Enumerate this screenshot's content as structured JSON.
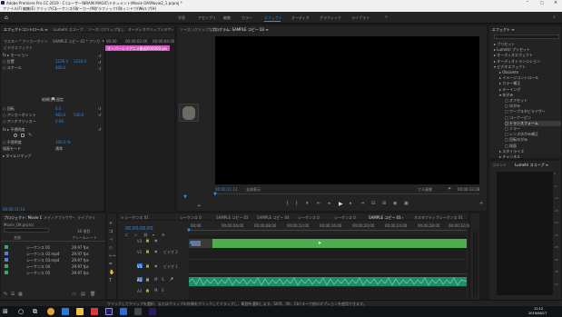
{
  "titlebar": {
    "title": "Adobe Premiere Pro CC 2019 - C:\\ユーザー\\NRAIN MAGIC\\ドキュメント\\Movie OA\\Movie2_1.prproj *"
  },
  "menu": [
    "ファイル(F)",
    "編集(E)",
    "クリップ(C)",
    "シーケンス(S)",
    "マーカー(M)",
    "グラフィック(G)",
    "ウィンドウ(W)",
    "ヘルプ(H)"
  ],
  "workspaces": [
    "学習",
    "アセンブリ",
    "編集",
    "カラー",
    "エフェクト",
    "オーディオ",
    "グラフィック",
    "ライブラリ"
  ],
  "workspace_active": "エフェクト",
  "effect_controls": {
    "tabs": [
      "エフェクトコントロール ≡",
      "Lumetri スコープ",
      "ソース: (クリップなし)",
      "オーディオクリップミキサー: シーケンス 05"
    ],
    "clip_label": "マスター * アンカーポイント... ∨",
    "seq_label": "SAMPLE コピー 01 * アンカ...",
    "video_effects": "ビデオエフェクト",
    "rows": [
      {
        "label": "fx  ▸ モーション",
        "v1": "",
        "v2": ""
      },
      {
        "label": "      ○ 位置",
        "v1": "1226.0",
        "v2": "1226.0"
      },
      {
        "label": "      ○ スケール",
        "v1": "400.0",
        "v2": ""
      },
      {
        "label": "        縦横比を固定",
        "v1": "",
        "v2": ""
      },
      {
        "label": "      ○ 回転",
        "v1": "0.0",
        "v2": ""
      },
      {
        "label": "      ○ アンカーポイント",
        "v1": "960.0",
        "v2": "540.0"
      },
      {
        "label": "      ○ アンチフリッカー",
        "v1": "0.00",
        "v2": ""
      },
      {
        "label": "fx  ▸ 不透明度",
        "v1": "",
        "v2": ""
      },
      {
        "label": "      ○ 不透明度",
        "v1": "100.0 %",
        "v2": ""
      },
      {
        "label": "        描画モード",
        "v1": "通常",
        "v2": ""
      },
      {
        "label": "▸ タイムリマップ",
        "v1": "",
        "v2": ""
      }
    ],
    "clip_name": "オーバーレイアニメ動画000000.png",
    "timecodes": [
      "00:00",
      "00:00:02:00",
      "00:00:04:00",
      "00:00:06:00"
    ],
    "current_time": "00:00:11:14"
  },
  "program": {
    "tab": "プログラム: SAMPLE コピー 03 ≡",
    "timecode_left": "00:00:11:14",
    "fit": "全体表示",
    "quality": "フル画質",
    "timecode_right": "00:00:33:28"
  },
  "project": {
    "tabs": [
      "プロジェクト: Movie OA_1 ≡",
      "メディアブラウザー",
      "ライブラリ"
    ],
    "file": "Movie_OA.prproj",
    "count": "16 項目",
    "col_name": "名前",
    "col_rate": "フレームレート",
    "items": [
      {
        "name": "シーケンス 01",
        "rate": "29.97 fps",
        "color": "#3aa86a"
      },
      {
        "name": "シーケンス 02.mp4",
        "rate": "29.97 fps",
        "color": "#5a7fd6"
      },
      {
        "name": "シーケンス 03.mp4",
        "rate": "29.97 fps",
        "color": "#5a7fd6"
      },
      {
        "name": "シーケンス 04",
        "rate": "29.97 fps",
        "color": "#3aa86a"
      },
      {
        "name": "シーケンス 05",
        "rate": "29.97 fps",
        "color": "#3aa86a"
      }
    ]
  },
  "timeline": {
    "tabs": [
      "× シーケンス 01",
      "シーケンス 02",
      "SAMPLE コピー 03",
      "SAMPLE コピー 04",
      "シーケンス 03",
      "シーケンス 04",
      "SAMPLE コピー 03 ≡",
      "オルタナティブシーケンス 01"
    ],
    "active_tab": "SAMPLE コピー 03 ≡",
    "timecode": "00;00;00;00",
    "ruler": [
      "00;00",
      "00;00;04;00",
      "00;00;08;00",
      "00;00;12;00",
      "00;00;16;00",
      "00;00;20;00",
      "00;00;24;00",
      "00;00;28;00",
      "00;00;32;00"
    ],
    "tracks": [
      {
        "name": "V3",
        "label": ""
      },
      {
        "name": "V2",
        "label": "ビデオ 2"
      },
      {
        "name": "V1",
        "label": "ビデオ 1"
      },
      {
        "name": "A1",
        "label": ""
      },
      {
        "name": "A2",
        "label": ""
      }
    ],
    "master": "マスター",
    "master_value": "0.0"
  },
  "effects": {
    "title": "エフェクト ≡",
    "items": [
      {
        "label": "▸ プリセット",
        "indent": 0
      },
      {
        "label": "▸ Lumetri プリセット",
        "indent": 0
      },
      {
        "label": "▸ オーディオエフェクト",
        "indent": 0
      },
      {
        "label": "▸ オーディオトランジション",
        "indent": 0
      },
      {
        "label": "▾ ビデオエフェクト",
        "indent": 0
      },
      {
        "label": "▸ Obsolete",
        "indent": 1
      },
      {
        "label": "▸ イメージコントロール",
        "indent": 1
      },
      {
        "label": "▸ カラー補正",
        "indent": 1
      },
      {
        "label": "▸ キーイング",
        "indent": 1
      },
      {
        "label": "▾ ゆがみ",
        "indent": 1
      },
      {
        "label": "□ オフセット",
        "indent": 2
      },
      {
        "label": "□ ゆがみ",
        "indent": 2
      },
      {
        "label": "□ ワープスタビライザー",
        "indent": 2
      },
      {
        "label": "□ コーナーピン",
        "indent": 2
      },
      {
        "label": "□ トランスフォーム",
        "indent": 2
      },
      {
        "label": "□ ミラー",
        "indent": 2
      },
      {
        "label": "□ レンズゆがみ補正",
        "indent": 2
      },
      {
        "label": "□ 回転ゆがみ",
        "indent": 2
      },
      {
        "label": "□ 球面",
        "indent": 2
      },
      {
        "label": "▸ スタイライズ",
        "indent": 1
      },
      {
        "label": "▸ チャンネル",
        "indent": 1
      }
    ],
    "lower_tabs": [
      "コメント",
      "Lumetri スコープ ≡"
    ],
    "scale_labels": [
      "0",
      "-6",
      "-12",
      "-18",
      "-24",
      "-30",
      "-36",
      "-42",
      "-48",
      "-54"
    ]
  },
  "status": "クリックしてクリップを選択、またはクリップの外側をクリックしてドラッグし、範囲を選択します。Shift、Alt、Ctrl キーで他のオプションを使用できます。",
  "clock": {
    "time": "11:12",
    "date": "2019/06/17"
  }
}
